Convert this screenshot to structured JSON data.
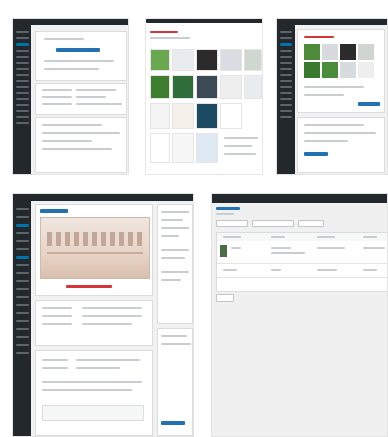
{
  "screens": [
    {
      "id": "editor-1",
      "layout": "wp-editor"
    },
    {
      "id": "media-grid",
      "layout": "media-library"
    },
    {
      "id": "editor-2",
      "layout": "wp-editor-media"
    },
    {
      "id": "editor-3",
      "layout": "wp-editor-image"
    },
    {
      "id": "list-table",
      "layout": "list-table"
    }
  ]
}
